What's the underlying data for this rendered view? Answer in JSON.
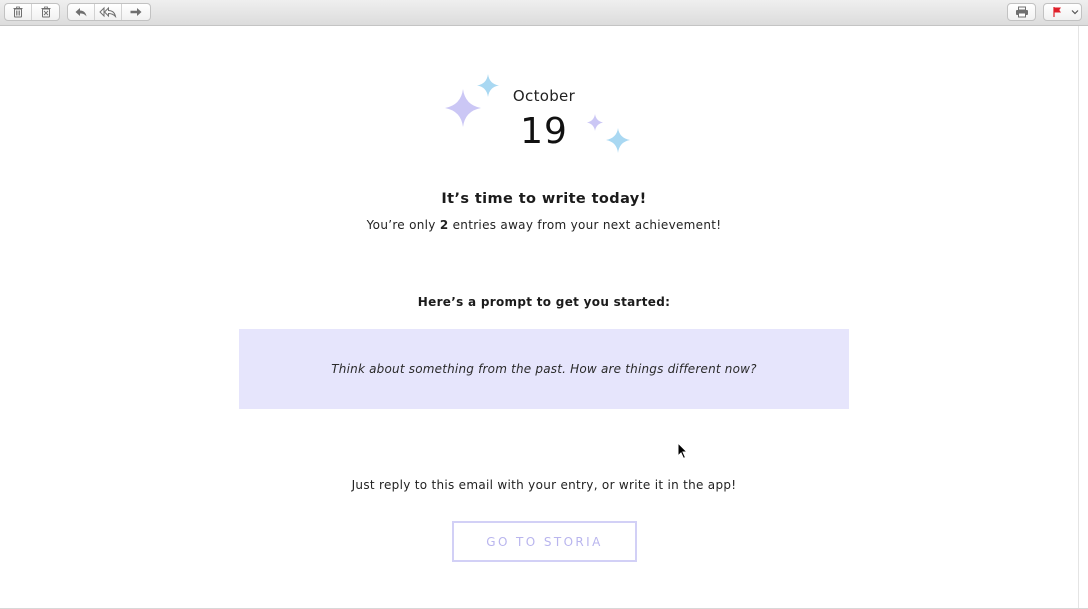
{
  "toolbar": {
    "left_buttons": [
      {
        "icon": "trash-icon"
      },
      {
        "icon": "junk-icon"
      },
      {
        "icon": "reply-icon"
      },
      {
        "icon": "reply-all-icon"
      },
      {
        "icon": "forward-icon"
      }
    ],
    "right_buttons": [
      {
        "icon": "print-icon"
      },
      {
        "icon": "flag-icon",
        "color": "#e0202a"
      },
      {
        "icon": "chevron-down-icon"
      }
    ]
  },
  "email": {
    "date": {
      "month": "October",
      "day": "19"
    },
    "headline": "It’s time to write today!",
    "achievement": {
      "prefix": "You’re only",
      "count": "2",
      "suffix": "entries away from your next achievement!"
    },
    "prompt_label": "Here’s a prompt to get you started:",
    "prompt_text": "Think about something from the past. How are things different now?",
    "reply_text": "Just reply to this email with your entry, or write it in the app!",
    "cta_label": "GO TO STORIA"
  },
  "colors": {
    "sparkle_purple": "#cbc7f5",
    "sparkle_blue": "#a9d8f2",
    "prompt_background": "#e6e5fc",
    "cta_border": "#d2d0f6",
    "cta_text": "#b9b5ee"
  }
}
